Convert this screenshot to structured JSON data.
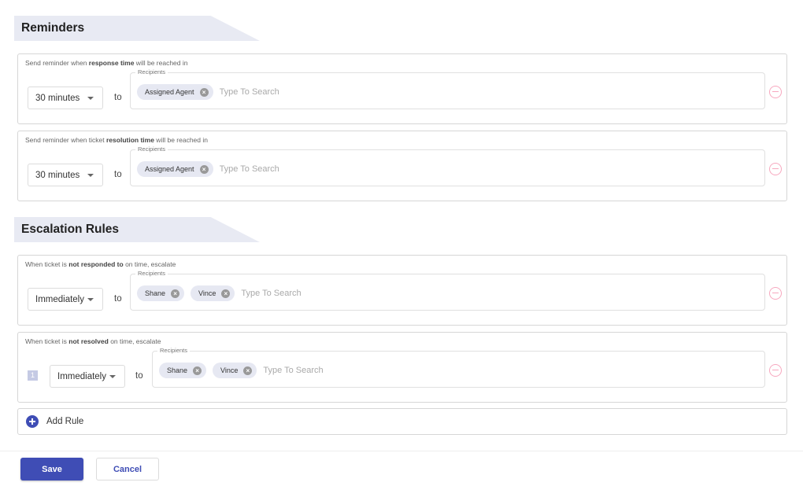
{
  "reminders": {
    "title": "Reminders",
    "rules": [
      {
        "desc_pre": "Send reminder when ",
        "desc_bold": "response time",
        "desc_post": " will be reached in",
        "select_value": "30 minutes",
        "to_label": "to",
        "recipients_label": "Recipients",
        "chips": [
          "Assigned Agent"
        ],
        "search_placeholder": "Type To Search"
      },
      {
        "desc_pre": "Send reminder when ticket ",
        "desc_bold": "resolution time",
        "desc_post": " will be reached in",
        "select_value": "30 minutes",
        "to_label": "to",
        "recipients_label": "Recipients",
        "chips": [
          "Assigned Agent"
        ],
        "search_placeholder": "Type To Search"
      }
    ]
  },
  "escalation": {
    "title": "Escalation Rules",
    "rules": [
      {
        "desc_pre": "When ticket is ",
        "desc_bold": "not responded to",
        "desc_post": " on time, escalate",
        "select_value": "Immediately",
        "to_label": "to",
        "recipients_label": "Recipients",
        "chips": [
          "Shane",
          "Vince"
        ],
        "search_placeholder": "Type To Search"
      },
      {
        "desc_pre": "When ticket is ",
        "desc_bold": "not resolved",
        "desc_post": " on time, escalate",
        "level": "1",
        "select_value": "Immediately",
        "to_label": "to",
        "recipients_label": "Recipients",
        "chips": [
          "Shane",
          "Vince"
        ],
        "search_placeholder": "Type To Search"
      }
    ],
    "add_rule_label": "Add Rule"
  },
  "footer": {
    "save_label": "Save",
    "cancel_label": "Cancel"
  },
  "colors": {
    "primary": "#3f4db5",
    "remove": "#f7a8bf",
    "chip_bg": "#e6e8f2",
    "header_bg": "#e8eaf3"
  }
}
